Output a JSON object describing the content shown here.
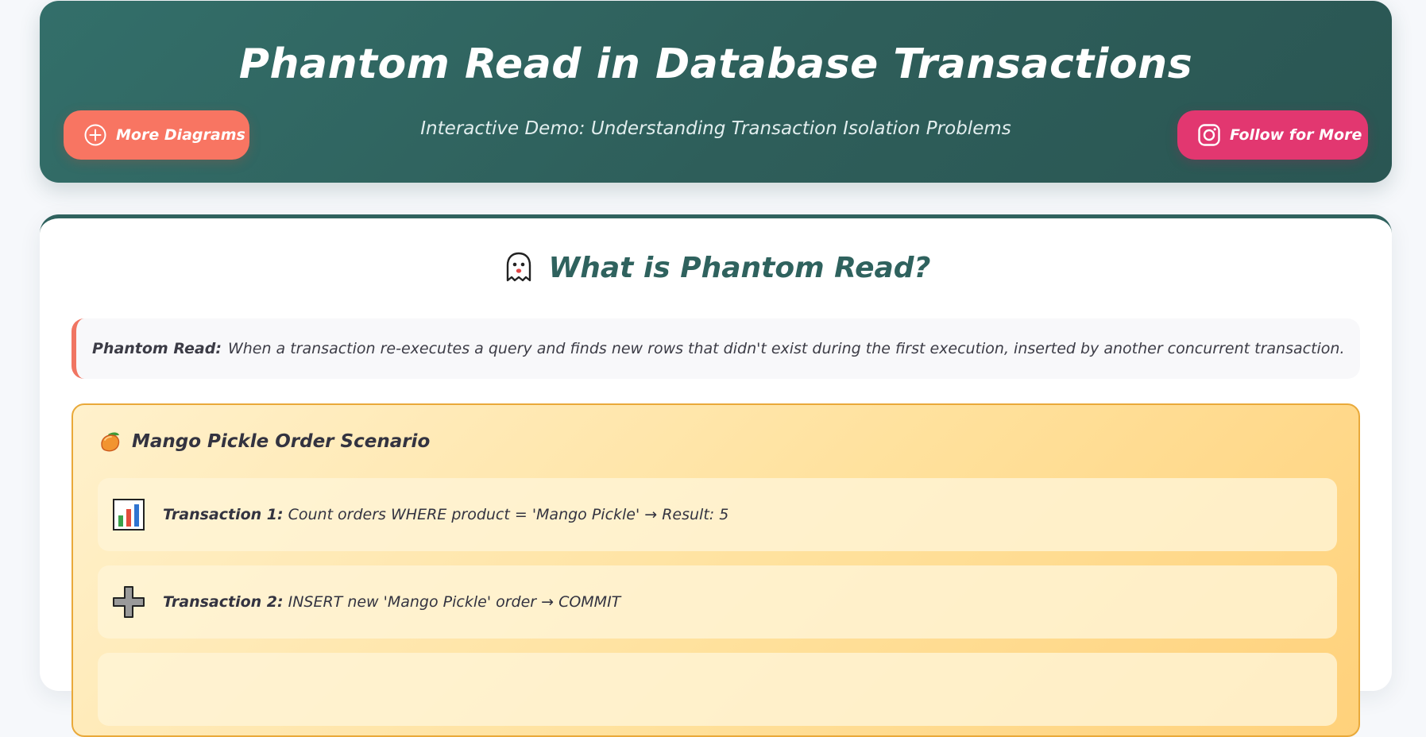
{
  "header": {
    "title": "Phantom Read in Database Transactions",
    "subtitle": "Interactive Demo: Understanding Transaction Isolation Problems",
    "more_button": {
      "label": "More Diagrams",
      "icon": "plus-circle-icon"
    },
    "follow_button": {
      "label": "Follow for More",
      "icon": "instagram-icon"
    }
  },
  "section": {
    "title": "What is Phantom Read?",
    "icon": "ghost-icon"
  },
  "definition": {
    "term": "Phantom Read:",
    "text": "When a transaction re-executes a query and finds new rows that didn't exist during the first execution, inserted by another concurrent transaction."
  },
  "scenario": {
    "title": "Mango Pickle Order Scenario",
    "icon": "mango-icon",
    "steps": [
      {
        "icon": "bar-chart-icon",
        "label": "Transaction 1:",
        "text": "Count orders WHERE product = 'Mango Pickle' → Result: 5"
      },
      {
        "icon": "plus-icon",
        "label": "Transaction 2:",
        "text": "INSERT new 'Mango Pickle' order → COMMIT"
      }
    ]
  },
  "colors": {
    "header_bg": "#2f625e",
    "accent_coral": "#f87562",
    "accent_pink": "#e23770",
    "scenario_border": "#e9a93a"
  }
}
